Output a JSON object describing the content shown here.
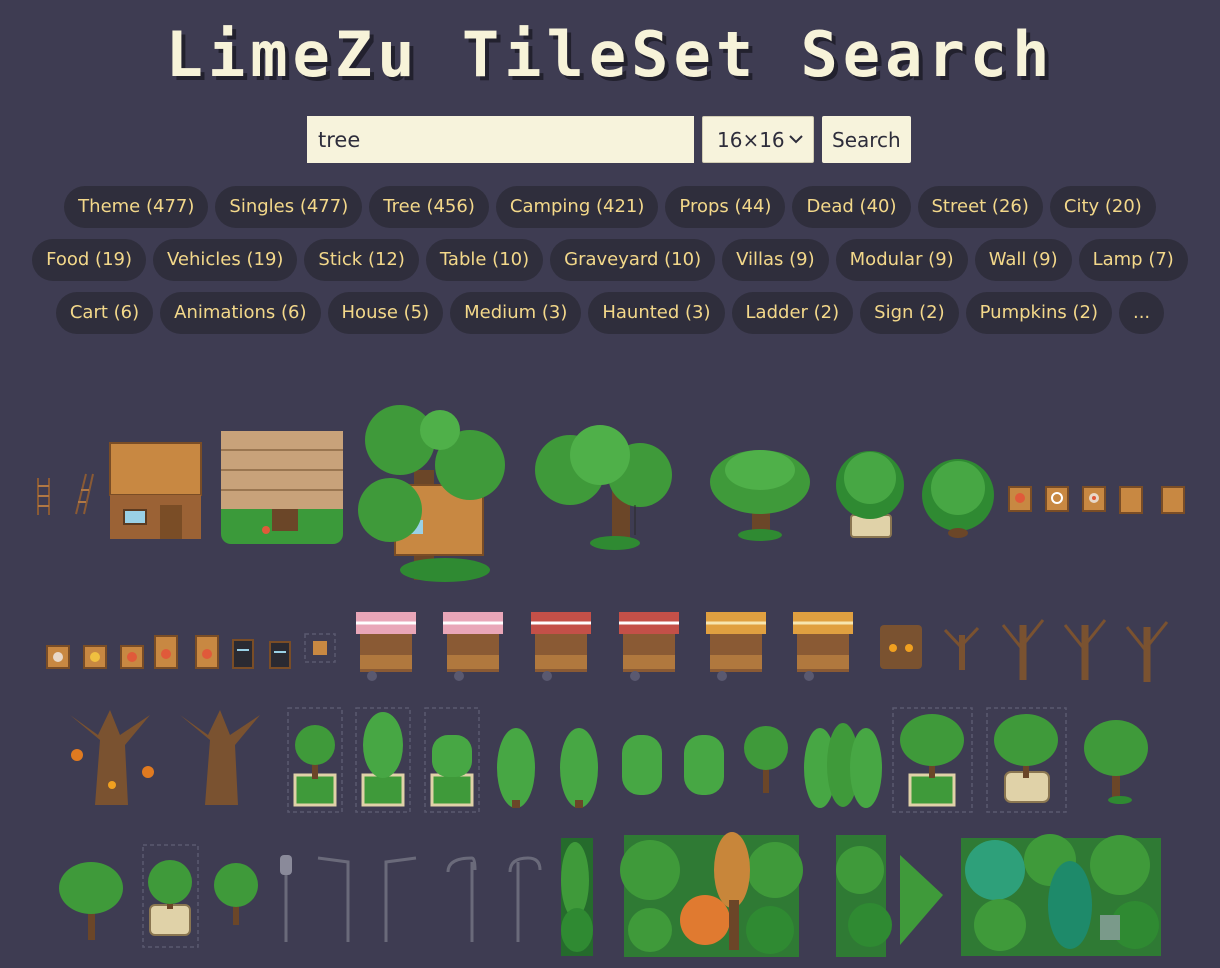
{
  "header": {
    "title": "LimeZu TileSet Search"
  },
  "search": {
    "query": "tree",
    "tile_size": "16×16",
    "button_label": "Search"
  },
  "tags": {
    "row1": [
      "Theme (477)",
      "Singles (477)",
      "Tree (456)",
      "Camping (421)",
      "Props (44)",
      "Dead (40)",
      "Street (26)",
      "City (20)"
    ],
    "row2": [
      "Food (19)",
      "Vehicles (19)",
      "Stick (12)",
      "Table (10)",
      "Graveyard (10)",
      "Villas (9)",
      "Modular (9)",
      "Wall (9)",
      "Lamp (7)"
    ],
    "row3": [
      "Cart (6)",
      "Animations (6)",
      "House (5)",
      "Medium (3)",
      "Haunted (3)",
      "Ladder (2)",
      "Sign (2)",
      "Pumpkins (2)",
      "..."
    ]
  },
  "results": {
    "row1": [
      "ladder",
      "ladder-leaning",
      "wooden-cabin",
      "log-roof-platform",
      "treehouse",
      "large-oak-with-swing",
      "wide-oak",
      "round-bush-planter",
      "round-bush",
      "sign-food",
      "sign-ring",
      "sign-target",
      "crate-small",
      "crate-small-2"
    ],
    "row2": [
      "sign-1",
      "sign-2",
      "sign-3",
      "sign-4",
      "sign-5",
      "menu-board-1",
      "menu-board-2",
      "crate-tiny",
      "stall-pink",
      "stall-pink-2",
      "stall-red",
      "stall-red-2",
      "stall-orange",
      "stall-orange-2",
      "haunted-stump",
      "dead-tree-small",
      "dead-tree-1",
      "dead-tree-2",
      "dead-tree-3"
    ],
    "row3": [
      "haunted-tree-pumpkins",
      "haunted-tree",
      "tree-planter",
      "cone-tree-planter",
      "bush-planter",
      "cone-tree-1",
      "cone-tree-2",
      "round-shrub-1",
      "round-shrub-2",
      "small-tree",
      "cypress-row",
      "tree-planter-2",
      "tree-pot",
      "tree-grass"
    ],
    "row4": [
      "tree-1",
      "tree-planter-3",
      "tree-2",
      "lamp-post",
      "street-lamp-1",
      "street-lamp-2",
      "street-lamp-double-1",
      "street-lamp-double-2",
      "forest-edge",
      "autumn-forest",
      "forest-piece",
      "forest-piece-2",
      "dense-forest"
    ]
  },
  "colors": {
    "background": "#3e3c52",
    "chip_background": "#2f2e3c",
    "chip_text": "#f3d88a",
    "leaf": "#3f9a3a",
    "leaf_dark": "#256b2c",
    "trunk": "#6b4628",
    "wood": "#c98a46"
  }
}
